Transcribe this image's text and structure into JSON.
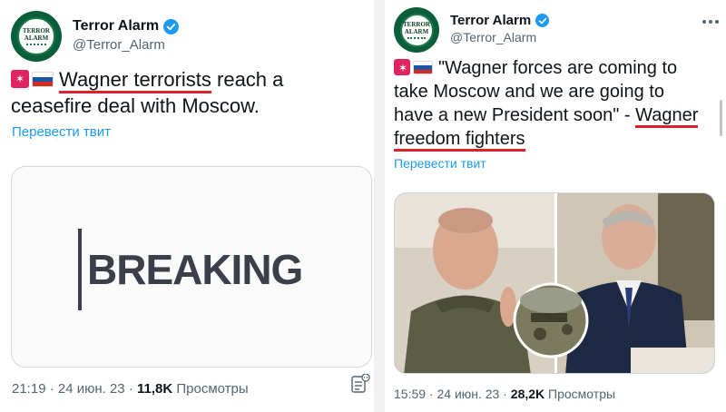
{
  "left": {
    "author": {
      "name": "Terror Alarm",
      "handle": "@Terror_Alarm",
      "avatar_text_1": "TERROR",
      "avatar_text_2": "ALARM"
    },
    "text_underlined": "Wagner terrorists",
    "text_rest_1": " reach a",
    "text_line_2": "ceasefire deal with Moscow.",
    "translate": "Перевести твит",
    "media_text": "BREAKING",
    "time": "21:19 · 24 июн. 23 · ",
    "views_count": "11,8K",
    "views_label": " Просмотры"
  },
  "right": {
    "author": {
      "name": "Terror Alarm",
      "handle": "@Terror_Alarm",
      "avatar_text_1": "TERROR",
      "avatar_text_2": "ALARM"
    },
    "text_line_1": "\"Wagner forces are coming to",
    "text_line_2": "take Moscow and we are going to",
    "text_line_3_pre": "have a new President soon\" - ",
    "text_line_3_underlined": "Wagner",
    "text_line_4_underlined": "freedom fighters",
    "translate": "Перевести твит",
    "time": "15:59 · 24 июн. 23 · ",
    "views_count": "28,2K",
    "views_label": " Просмотры"
  },
  "icons": {
    "siren": "police-light-icon",
    "flag": "russia-flag-icon",
    "verified": "verified-badge-icon",
    "analytics": "analytics-icon",
    "more": "more-icon"
  },
  "colors": {
    "link": "#1d9bf0",
    "underline": "#e0202a",
    "verified": "#1d9bf0",
    "muted": "#536471",
    "avatar": "#0b5d3b"
  }
}
